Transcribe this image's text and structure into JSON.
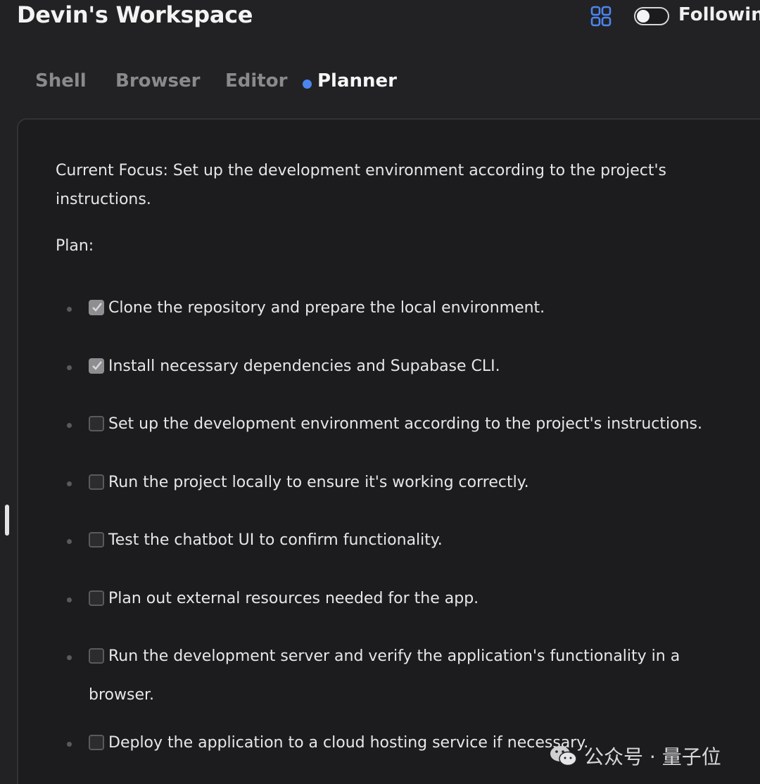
{
  "header": {
    "title": "Devin's Workspace",
    "grid_icon": "grid-icon",
    "grid_icon_color": "#4b86f0",
    "following_toggle_on": false,
    "following_label": "Following"
  },
  "tabs": [
    {
      "label": "Shell",
      "active": false
    },
    {
      "label": "Browser",
      "active": false
    },
    {
      "label": "Editor",
      "active": false
    },
    {
      "label": "Planner",
      "active": true
    }
  ],
  "planner": {
    "current_focus": "Current Focus: Set up the development environment according to the project's instructions.",
    "plan_label": "Plan:",
    "items": [
      {
        "text": "Clone the repository and prepare the local environment.",
        "done": true
      },
      {
        "text": "Install necessary dependencies and Supabase CLI.",
        "done": true
      },
      {
        "text": "Set up the development environment according to the project's instructions.",
        "done": false
      },
      {
        "text": "Run the project locally to ensure it's working correctly.",
        "done": false
      },
      {
        "text": "Test the chatbot UI to confirm functionality.",
        "done": false
      },
      {
        "text": "Plan out external resources needed for the app.",
        "done": false
      },
      {
        "text": "Run the development server and verify the application's functionality in a",
        "continuation": "browser.",
        "done": false
      },
      {
        "text": "Deploy the application to a cloud hosting service if necessary.",
        "done": false
      }
    ]
  },
  "watermark": {
    "icon": "wechat-icon",
    "text": "公众号 · 量子位"
  },
  "colors": {
    "background": "#222224",
    "panel": "#1c1c1e",
    "accent": "#4b86f0"
  }
}
